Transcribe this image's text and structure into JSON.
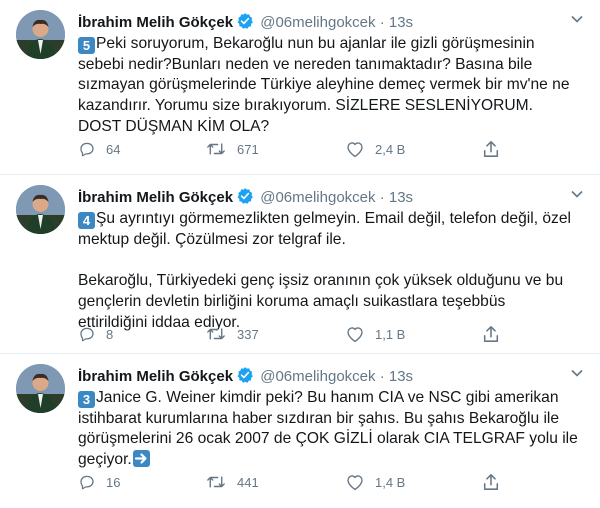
{
  "tweets": [
    {
      "name": "İbrahim Melih Gökçek",
      "handle": "@06melihgokcek",
      "dot": "·",
      "time": "13s",
      "number": "5",
      "text": "Peki soruyorum, Bekaroğlu nun bu ajanlar ile gizli görüşmesinin sebebi nedir?Bunları neden ve nereden tanımaktadır? Basına bile sızmayan görüşmelerinde Türkiye aleyhine demeç vermek bir mv'ne ne kazandırır. Yorumu size bırakıyorum. SİZLERE SESLENİYORUM. DOST DÜŞMAN KİM OLA?",
      "replies": "64",
      "retweets": "671",
      "likes": "2,4 B"
    },
    {
      "name": "İbrahim Melih Gökçek",
      "handle": "@06melihgokcek",
      "dot": "·",
      "time": "13s",
      "number": "4",
      "text": "Şu ayrıntıyı görmemezlikten gelmeyin. Email değil, telefon değil, özel mektup değil. Çözülmesi zor telgraf ile.\n\nBekaroğlu, Türkiyedeki genç işsiz oranının çok yüksek olduğunu ve bu gençlerin devletin birliğini koruma amaçlı suikastlara teşebbüs ettirildiğini iddaa ediyor.",
      "replies": "8",
      "retweets": "337",
      "likes": "1,1 B"
    },
    {
      "name": "İbrahim Melih Gökçek",
      "handle": "@06melihgokcek",
      "dot": "·",
      "time": "13s",
      "number": "3",
      "text": "Janice G. Weiner kimdir peki? Bu hanım CIA ve NSC gibi amerikan istihbarat kurumlarına haber sızdıran bir şahıs. Bu şahıs Bekaroğlu ile görüşmelerini 26 ocak 2007 de ÇOK GİZLİ olarak CIA TELGRAF yolu ile geçiyor.",
      "replies": "16",
      "retweets": "441",
      "likes": "1,4 B"
    }
  ],
  "colors": {
    "verified": "#1da1f2",
    "keycap": "#3b88c3",
    "muted": "#657786",
    "divider": "#e6ecf0"
  },
  "icons": {
    "reply": "reply-icon",
    "retweet": "retweet-icon",
    "like": "like-icon",
    "share": "share-icon",
    "menu": "chevron-down-icon",
    "verified": "verified-badge-icon"
  }
}
